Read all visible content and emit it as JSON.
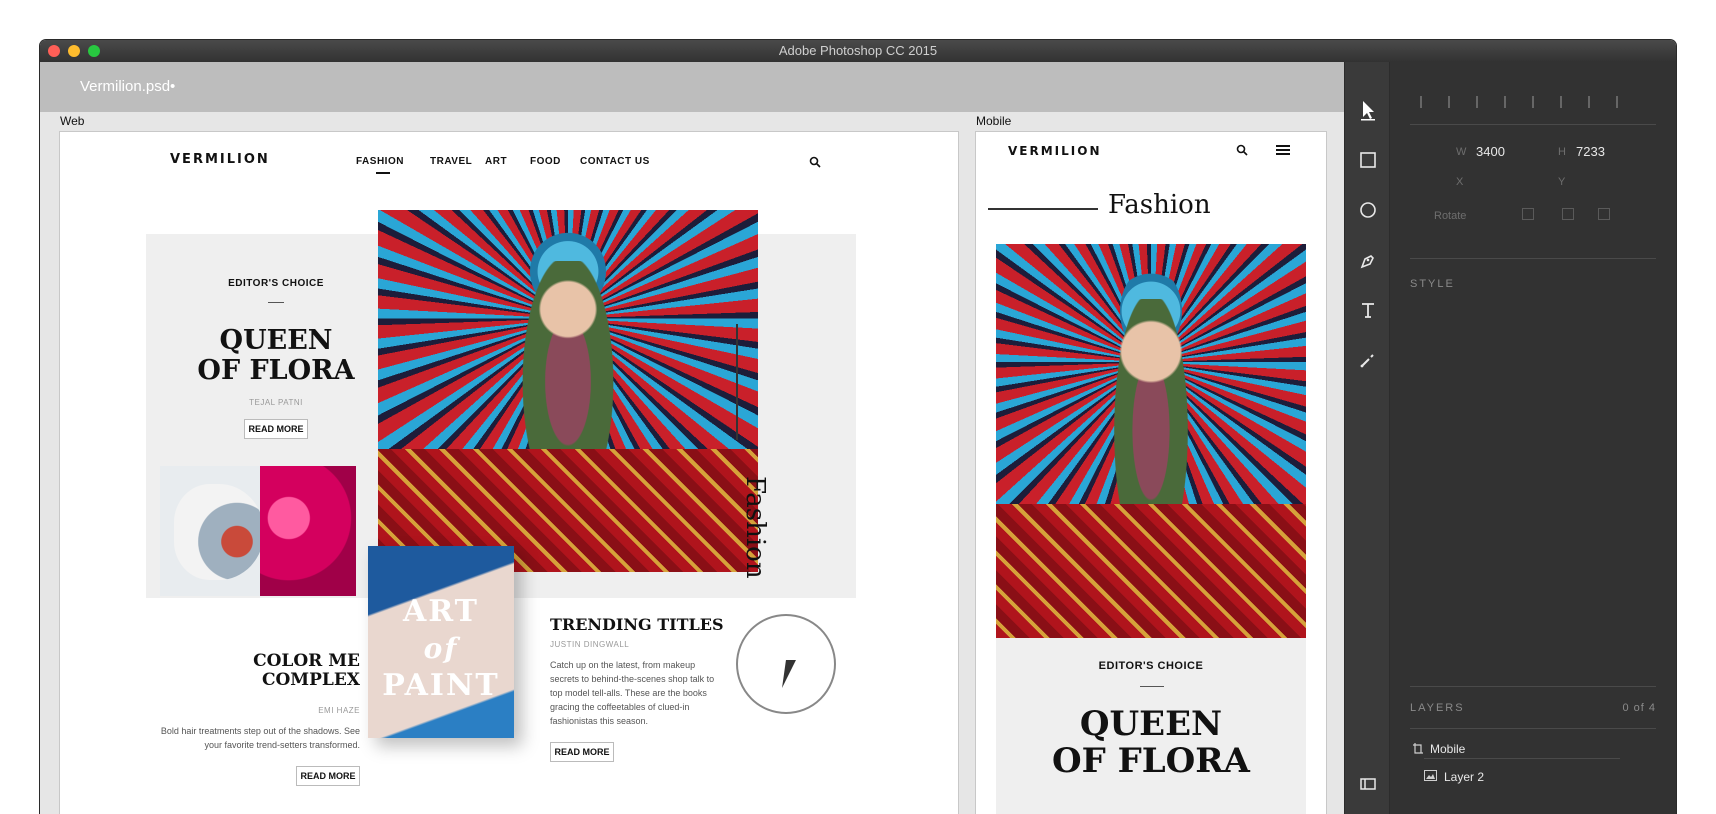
{
  "window": {
    "title": "Adobe Photoshop CC 2015",
    "document_title": "Vermilion.psd",
    "document_modified_mark": "•"
  },
  "artboards": {
    "web_label": "Web",
    "mobile_label": "Mobile"
  },
  "web": {
    "logo": "VERMILION",
    "nav": [
      "FASHION",
      "TRAVEL",
      "ART",
      "FOOD",
      "CONTACT US"
    ],
    "active_nav": "FASHION",
    "search_icon": "search-icon",
    "editors_choice": "EDITOR'S CHOICE",
    "feature_title_line1": "QUEEN",
    "feature_title_line2": "OF FLORA",
    "feature_author": "TEJAL PATNI",
    "feature_button": "READ MORE",
    "section_vertical": "Fashion",
    "color_title_line1": "COLOR ME",
    "color_title_line2": "COMPLEX",
    "color_author": "EMI HAZE",
    "color_desc": "Bold hair treatments step out of the shadows. See your favorite trend-setters transformed.",
    "color_button": "READ MORE",
    "art_line1": "ART",
    "art_line2": "of",
    "art_line3": "PAINT",
    "trending_title": "TRENDING TITLES",
    "trending_author": "JUSTIN DINGWALL",
    "trending_desc": "Catch up on the latest, from makeup secrets to behind-the-scenes shop talk to top model tell-alls. These are the books gracing the coffeetables of clued-in fashionistas this season.",
    "trending_button": "READ MORE"
  },
  "mobile": {
    "logo": "VERMILION",
    "section": "Fashion",
    "editors_choice": "EDITOR'S CHOICE",
    "title_line1": "QUEEN",
    "title_line2": "OF FLORA"
  },
  "tools": [
    "select-arrow-icon",
    "rectangle-icon",
    "ellipse-icon",
    "pen-icon",
    "type-icon",
    "eyedropper-icon",
    "panel-toggle-icon"
  ],
  "properties": {
    "w_label": "W",
    "w_value": "3400",
    "h_label": "H",
    "h_value": "7233",
    "x_label": "X",
    "y_label": "Y",
    "rotate_label": "Rotate",
    "style_title": "STYLE",
    "layers_title": "LAYERS",
    "layers_count": "0 of 4",
    "layers": [
      {
        "name": "Mobile",
        "icon": "artboard-icon"
      },
      {
        "name": "Layer 2",
        "icon": "image-icon"
      }
    ]
  }
}
